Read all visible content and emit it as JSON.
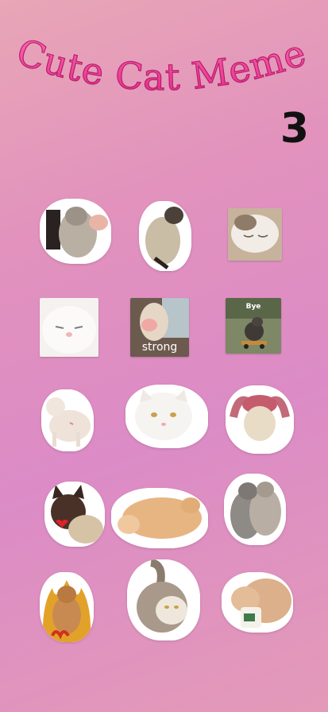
{
  "header": {
    "title": "Cute Cat Meme",
    "number": "3"
  },
  "colors": {
    "title_pink": "#f23c96",
    "title_outline": "#c8237a",
    "number_color": "#111111"
  },
  "stickers": [
    {
      "name": "cat-held-sticker",
      "caption": ""
    },
    {
      "name": "cat-stretching-sticker",
      "caption": ""
    },
    {
      "name": "cat-sleeping-sticker",
      "caption": ""
    },
    {
      "name": "white-cat-closeup-sticker",
      "caption": ""
    },
    {
      "name": "cat-strong-sticker",
      "caption": "strong"
    },
    {
      "name": "cat-skateboard-bye-sticker",
      "caption": "Bye"
    },
    {
      "name": "cat-standing-sticker",
      "caption": ""
    },
    {
      "name": "white-cat-sitting-sticker",
      "caption": ""
    },
    {
      "name": "cat-bunny-hat-sticker",
      "caption": ""
    },
    {
      "name": "siamese-cat-heart-sticker",
      "caption": ""
    },
    {
      "name": "ginger-cat-lying-sticker",
      "caption": ""
    },
    {
      "name": "tabby-cats-hugging-sticker",
      "caption": ""
    },
    {
      "name": "cat-fire-sticker",
      "caption": ""
    },
    {
      "name": "tabby-cat-rolling-sticker",
      "caption": ""
    },
    {
      "name": "ginger-cat-cup-sticker",
      "caption": ""
    }
  ]
}
